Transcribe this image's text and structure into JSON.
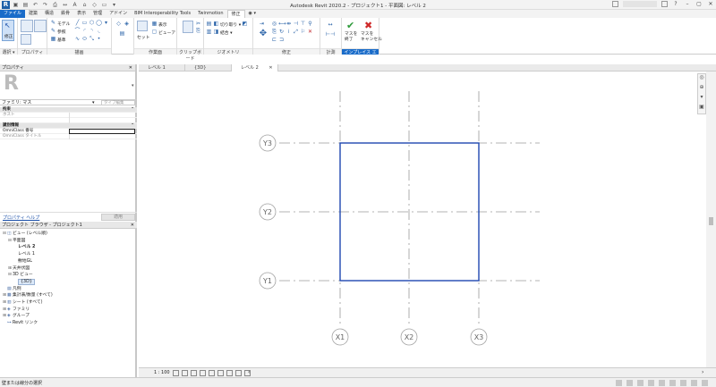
{
  "window": {
    "title": "Autodesk Revit 2020.2 - プロジェクト1 - 平面図: レベル 2",
    "logo": "R"
  },
  "ribbon_tabs": [
    "ファイル",
    "建築",
    "構造",
    "鉄骨",
    "表示",
    "管理",
    "アドイン",
    "BIM Interoperability Tools",
    "Twinmotion",
    "修正"
  ],
  "ribbon": {
    "select_label": "修正",
    "panels": {
      "select": "選択 ▾",
      "properties": "プロパティ",
      "draw": "描画",
      "workplane": "作業面",
      "clipboard": "クリップボード",
      "geometry": "ジオメトリ",
      "modify": "修正",
      "measure": "計測",
      "inplace": "インプレイス エディタ"
    },
    "draw_texts": [
      "モデル",
      "参照",
      "基準"
    ],
    "workplane_texts": [
      "セット",
      "表示",
      "ビューア"
    ],
    "geometry_texts": [
      "切り取り ▾",
      "結合 ▾"
    ],
    "finish_label": "マスを\n終了",
    "cancel_label": "マスを\nキャンセル"
  },
  "doc_tabs": [
    "レベル 1",
    "{3D}",
    "レベル 2"
  ],
  "properties": {
    "title": "プロパティ",
    "family": "ファミリ: マス",
    "edit_type": "タイプ編集",
    "rows": [
      {
        "label": "拘束",
        "group": true
      },
      {
        "label": "ホスト",
        "gray": true
      },
      {
        "label": "",
        "gray": false
      },
      {
        "label": "識別情報",
        "group": true
      },
      {
        "label": "OmniClass 番号",
        "box": true
      },
      {
        "label": "OmniClass タイトル",
        "gray": true
      }
    ],
    "help_link": "プロパティ ヘルプ",
    "apply": "適用"
  },
  "browser": {
    "title": "プロジェクト ブラウザ - プロジェクト1",
    "nodes": [
      {
        "label": "ビュー (レベル順)",
        "indent": 0,
        "ex": "⊟",
        "ic": "◫"
      },
      {
        "label": "平面図",
        "indent": 1,
        "ex": "⊟",
        "ic": ""
      },
      {
        "label": "レベル 2",
        "indent": 2,
        "ex": "",
        "ic": "",
        "bold": true
      },
      {
        "label": "レベル 1",
        "indent": 2,
        "ex": "",
        "ic": ""
      },
      {
        "label": "敷地GL",
        "indent": 2,
        "ex": "",
        "ic": ""
      },
      {
        "label": "天井伏図",
        "indent": 1,
        "ex": "⊞",
        "ic": ""
      },
      {
        "label": "3D ビュー",
        "indent": 1,
        "ex": "⊟",
        "ic": ""
      },
      {
        "label": "{3D}",
        "indent": 2,
        "ex": "",
        "ic": "",
        "sel": true
      },
      {
        "label": "凡例",
        "indent": 0,
        "ex": "",
        "ic": "▤"
      },
      {
        "label": "集計表/数量 (すべて)",
        "indent": 0,
        "ex": "⊞",
        "ic": "▦"
      },
      {
        "label": "シート (すべて)",
        "indent": 0,
        "ex": "⊞",
        "ic": "▥"
      },
      {
        "label": "ファミリ",
        "indent": 0,
        "ex": "⊞",
        "ic": "◈"
      },
      {
        "label": "グループ",
        "indent": 0,
        "ex": "⊞",
        "ic": "◈"
      },
      {
        "label": "Revit リンク",
        "indent": 0,
        "ex": "",
        "ic": "⊶"
      }
    ]
  },
  "grids": {
    "y_labels": [
      "Y3",
      "Y2",
      "Y1"
    ],
    "x_labels": [
      "X1",
      "X2",
      "X3"
    ]
  },
  "status": {
    "scale": "1 : 100",
    "message": "壁または線分の選択"
  },
  "colors": {
    "file_tab": "#1a6cc9",
    "mass_outline": "#1f48b0",
    "grid": "#999999"
  }
}
